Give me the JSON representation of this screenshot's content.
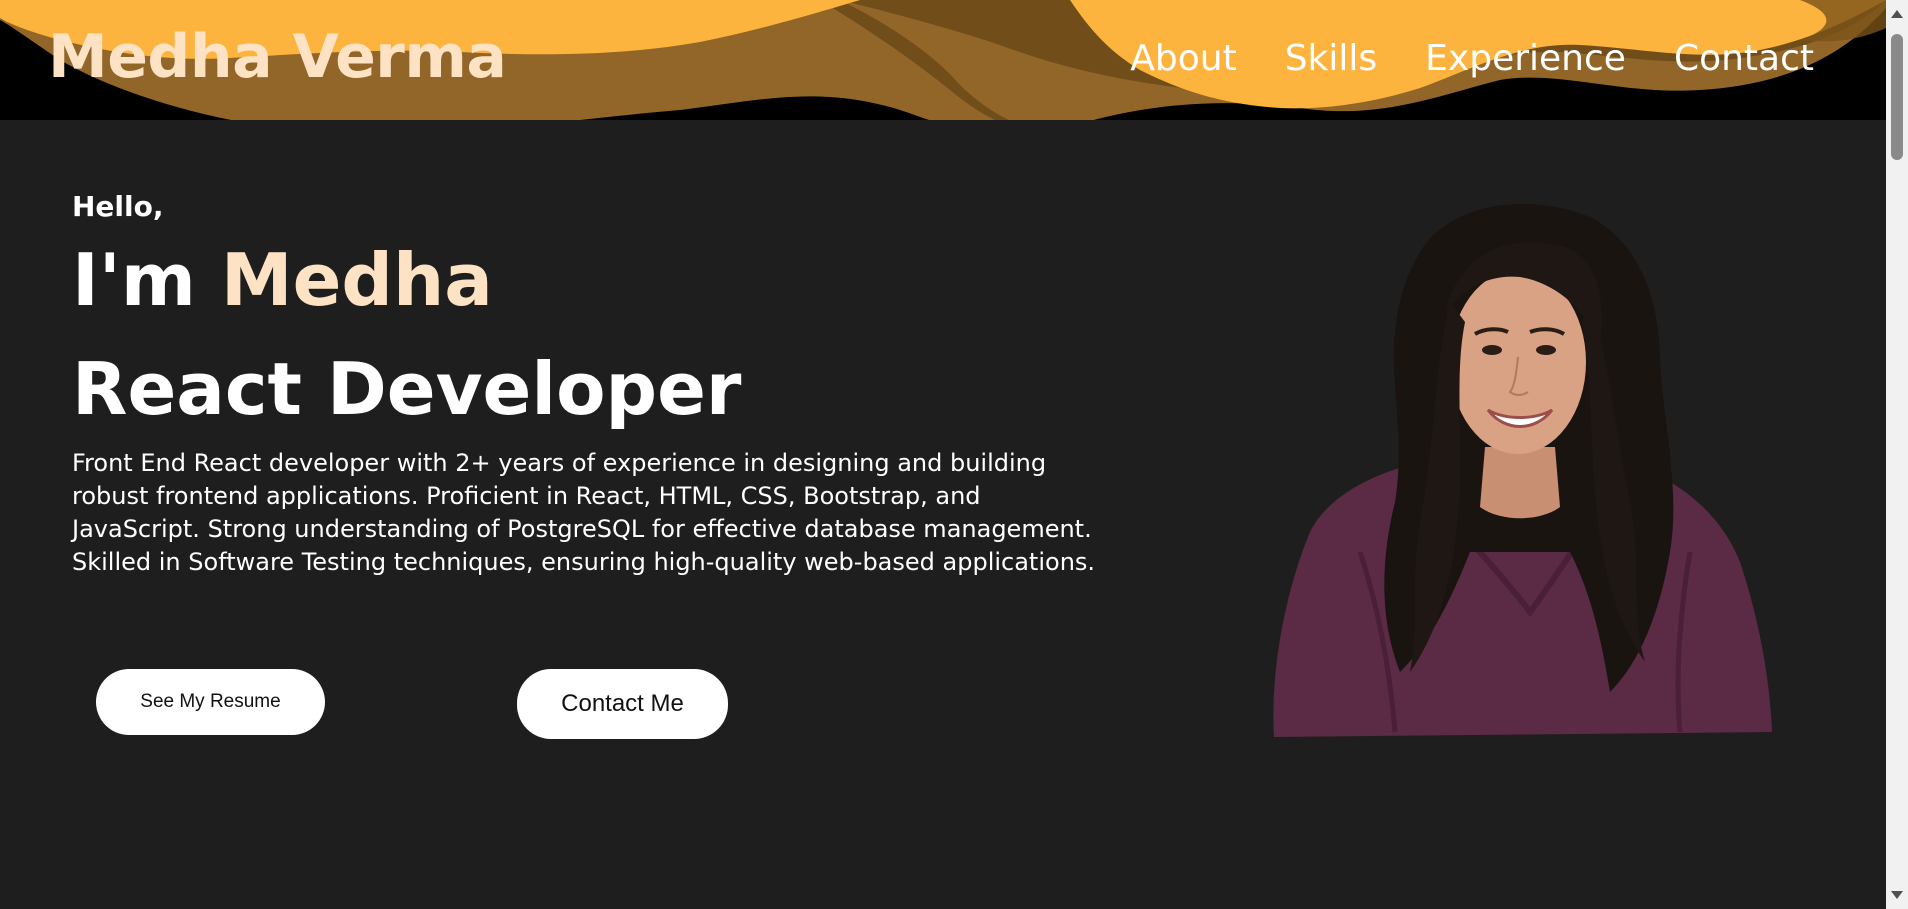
{
  "header": {
    "logo": "Medha Verma",
    "nav": [
      {
        "label": "About"
      },
      {
        "label": "Skills"
      },
      {
        "label": "Experience"
      },
      {
        "label": "Contact"
      }
    ]
  },
  "hero": {
    "greeting": "Hello,",
    "intro_prefix": "I'm ",
    "intro_name": "Medha",
    "role": "React Developer",
    "bio": "Front End React developer with 2+ years of experience in designing and building robust frontend applications. Proficient in React, HTML, CSS, Bootstrap, and JavaScript. Strong understanding of PostgreSQL for effective database management. Skilled in Software Testing techniques, ensuring high-quality web-based applications.",
    "resume_button": "See My Resume",
    "contact_button": "Contact Me"
  },
  "colors": {
    "background": "#1e1e1e",
    "header": "#000000",
    "accent_wave": "#fdb43f",
    "name_accent": "#fde3c3",
    "button": "#ffffff"
  },
  "icons": {
    "portrait": "profile-photo",
    "scroll_up": "chevron-up-icon",
    "scroll_down": "chevron-down-icon"
  }
}
